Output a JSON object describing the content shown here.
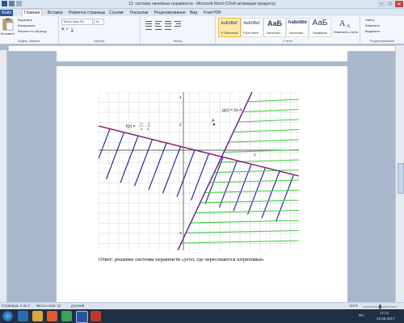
{
  "window": {
    "title": "13. система линейных неравенств  -  Microsoft Word (Сбой активации продукта)",
    "controls": [
      "–",
      "□",
      "✕"
    ]
  },
  "tabs": [
    "Файл",
    "Главная",
    "Вставка",
    "Разметка страницы",
    "Ссылки",
    "Рассылки",
    "Рецензирование",
    "Вид",
    "Foxit PDF"
  ],
  "clipboard": {
    "paste": "Вставить",
    "cut": "Вырезать",
    "copy": "Копировать",
    "format_painter": "Формат по образцу",
    "label": "Буфер обмена"
  },
  "font": {
    "name": "Times New Ro",
    "size": "14",
    "label": "Шрифт"
  },
  "paragraph": {
    "label": "Абзац"
  },
  "styles": {
    "items": [
      {
        "sample": "АаБбВвГ",
        "name": "¶ Обычный"
      },
      {
        "sample": "АаБбВвГ",
        "name": "¶ Без инте..."
      },
      {
        "sample": "АаБ",
        "name": "Заголово..."
      },
      {
        "sample": "АаБбВв",
        "name": "Заголово..."
      },
      {
        "sample": "АаБ",
        "name": "Название"
      }
    ],
    "change": "Изменить стили",
    "label": "Стили"
  },
  "editing": {
    "find": "Найти",
    "replace": "Заменить",
    "select": "Выделить",
    "label": "Редактирование"
  },
  "graph": {
    "f_label": "f(x) =",
    "f_num1": "-x",
    "f_den1": "4",
    "f_num2": "1",
    "f_den2": "4",
    "g_label": "g(x) = 2x-4",
    "point_label": "A",
    "y_tick_top": "4",
    "y_tick_mid": "2",
    "y_tick_bottom": "-6",
    "x_tick": "4",
    "line_color_f": "#8b1a6b",
    "line_color_g": "#6a1a8b",
    "hatch_blue": "#1f1f8f",
    "hatch_green": "#3ccc3c"
  },
  "answer_text": "Ответ: решение системы неравенств «угол, где пересекаются штриховки»",
  "status": {
    "page": "Страница: 2 из 2",
    "words": "Число слов: 11",
    "lang": "русский",
    "zoom": "111%"
  },
  "taskbar": {
    "lang": "RU",
    "time": "17:21",
    "date": "23.08.2017"
  }
}
